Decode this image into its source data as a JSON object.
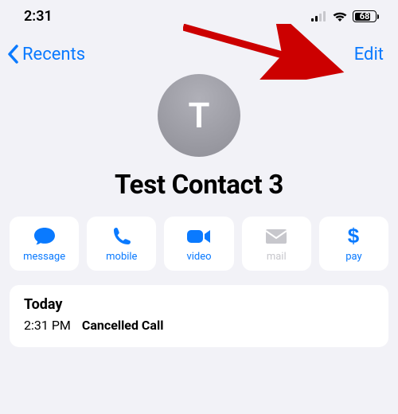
{
  "status": {
    "time": "2:31",
    "battery_pct": "68"
  },
  "nav": {
    "back_label": "Recents",
    "edit_label": "Edit"
  },
  "contact": {
    "initial": "T",
    "name": "Test Contact 3"
  },
  "actions": {
    "message": "message",
    "mobile": "mobile",
    "video": "video",
    "mail": "mail",
    "pay": "pay"
  },
  "history": {
    "title": "Today",
    "entries": [
      {
        "time": "2:31 PM",
        "type": "Cancelled Call"
      }
    ]
  },
  "colors": {
    "accent": "#0a7aff",
    "disabled": "#c7c7cc",
    "bg": "#f2f2f7",
    "annotation": "#cc0000"
  }
}
